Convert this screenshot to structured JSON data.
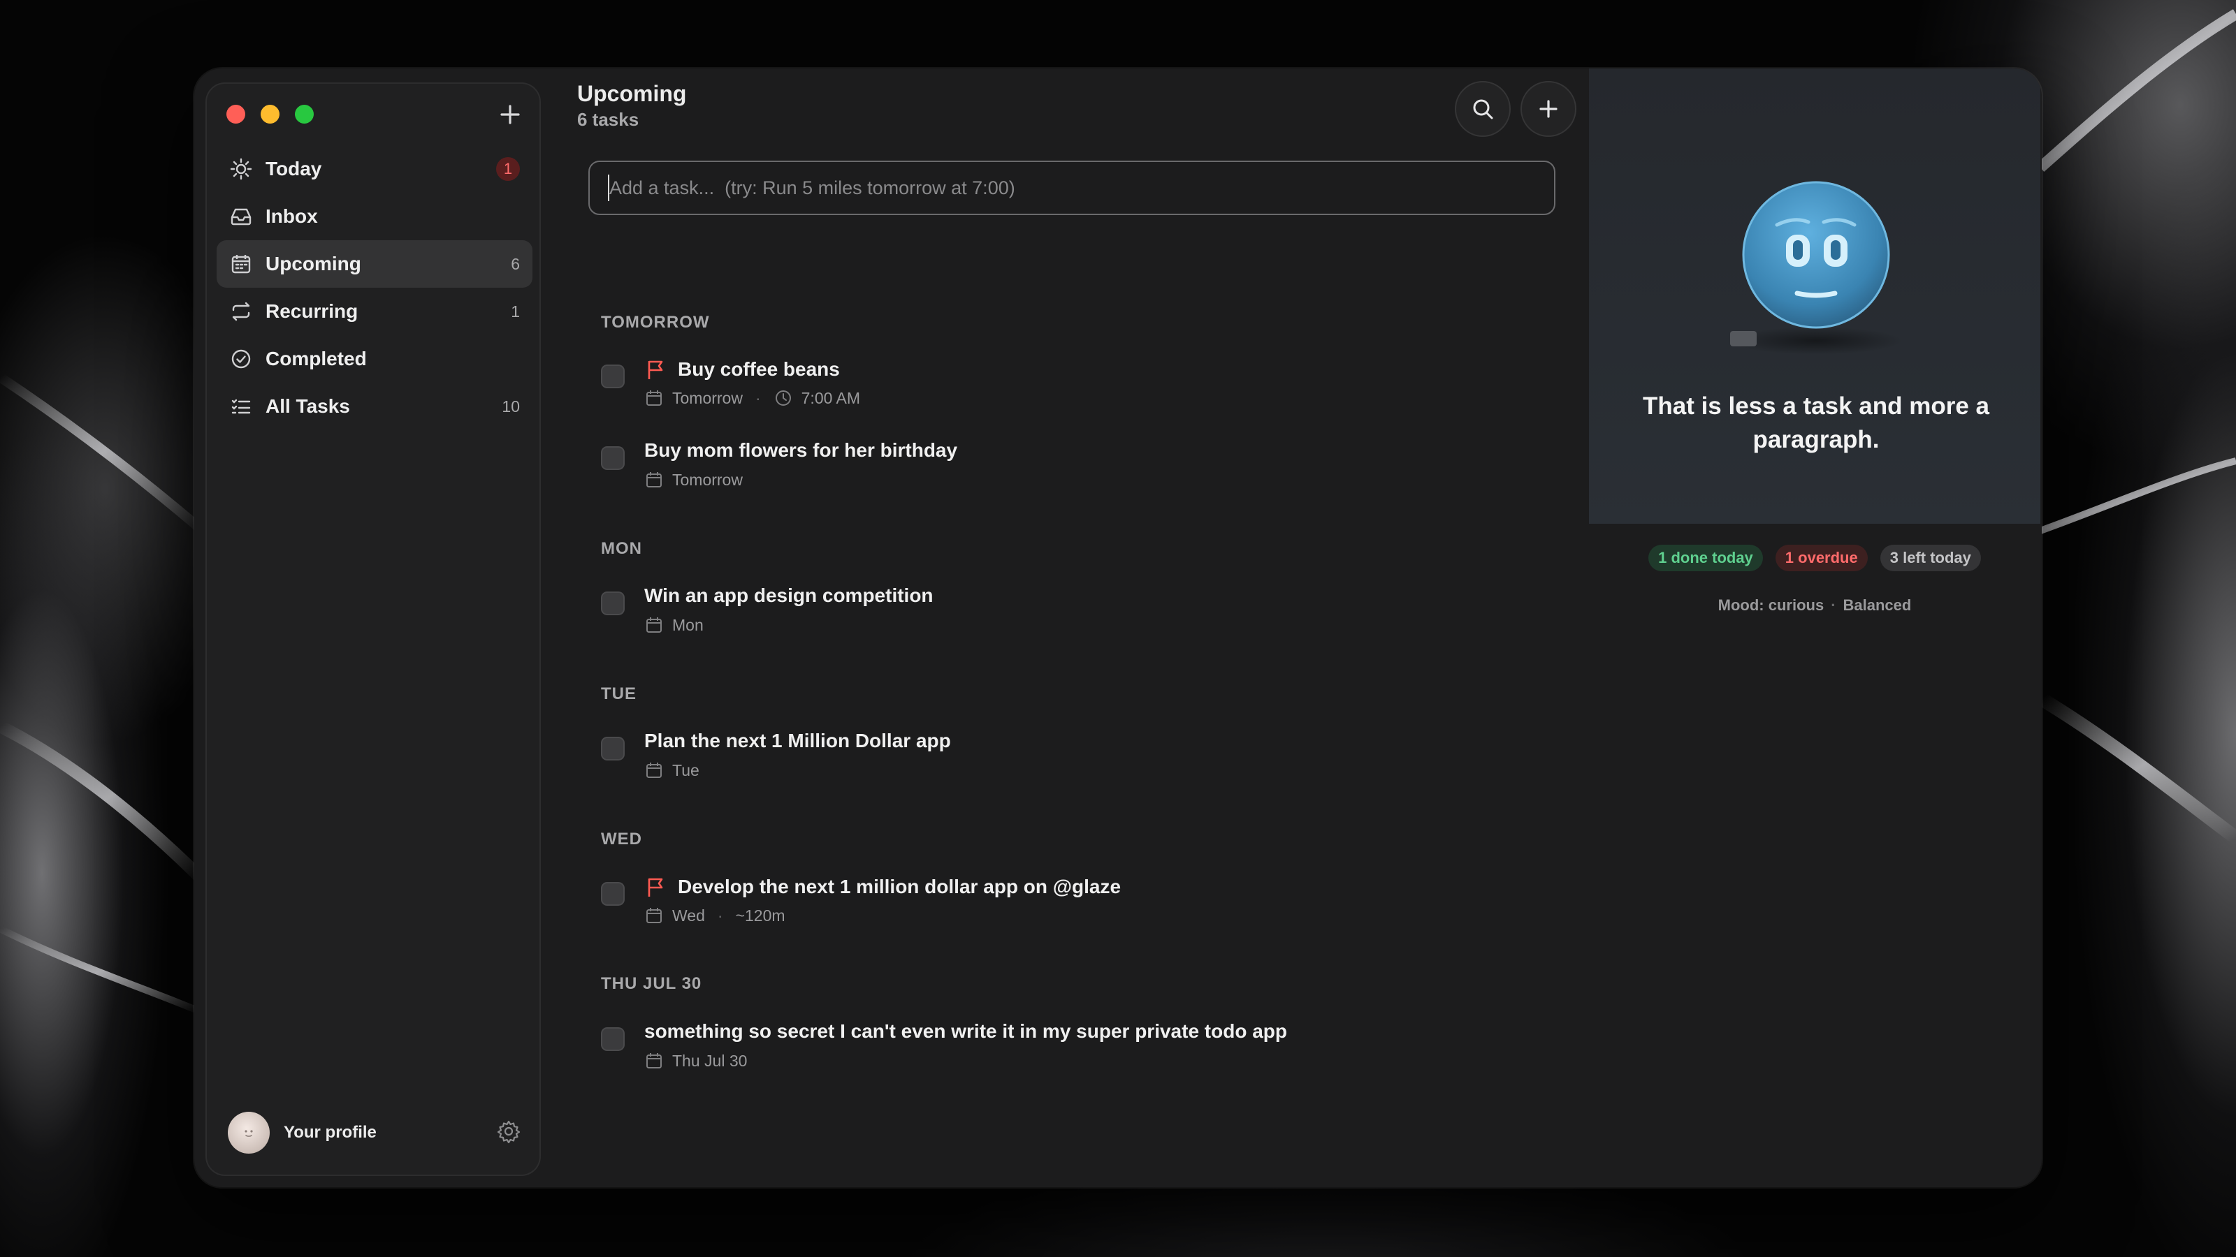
{
  "sidebar": {
    "items": [
      {
        "label": "Today",
        "count": "1",
        "icon": "sun-icon"
      },
      {
        "label": "Inbox",
        "count": "",
        "icon": "inbox-icon"
      },
      {
        "label": "Upcoming",
        "count": "6",
        "icon": "calendar-icon"
      },
      {
        "label": "Recurring",
        "count": "1",
        "icon": "repeat-icon"
      },
      {
        "label": "Completed",
        "count": "",
        "icon": "check-circle-icon"
      },
      {
        "label": "All Tasks",
        "count": "10",
        "icon": "list-icon"
      }
    ],
    "profile_label": "Your profile"
  },
  "header": {
    "title": "Upcoming",
    "subtitle": "6 tasks"
  },
  "add_task": {
    "placeholder": "Add a task...  (try: Run 5 miles tomorrow at 7:00)"
  },
  "sections": [
    {
      "heading": "TOMORROW",
      "tasks": [
        {
          "title": "Buy coffee beans",
          "flagged": true,
          "date": "Tomorrow",
          "time": "7:00 AM"
        },
        {
          "title": "Buy mom flowers for her birthday",
          "flagged": false,
          "date": "Tomorrow"
        }
      ]
    },
    {
      "heading": "MON",
      "tasks": [
        {
          "title": "Win an app design competition",
          "flagged": false,
          "date": "Mon"
        }
      ]
    },
    {
      "heading": "TUE",
      "tasks": [
        {
          "title": "Plan the next 1 Million Dollar app",
          "flagged": false,
          "date": "Tue"
        }
      ]
    },
    {
      "heading": "WED",
      "tasks": [
        {
          "title": "Develop the next 1 million dollar app on @glaze",
          "flagged": true,
          "date": "Wed",
          "duration": "~120m"
        }
      ]
    },
    {
      "heading": "THU JUL 30",
      "tasks": [
        {
          "title": "something so secret I can't even write it in my super private todo app",
          "flagged": false,
          "date": "Thu Jul 30"
        }
      ]
    }
  ],
  "assistant": {
    "message": "That is less a task and more a paragraph.",
    "stats": {
      "done": "1 done today",
      "overdue": "1 overdue",
      "left": "3 left today"
    },
    "mood": "Mood: curious",
    "mode": "Balanced"
  },
  "colors": {
    "flag": "#ff5a52",
    "done_green": "#5fd08f",
    "overdue_red": "#ff6b6b",
    "mascot_blue": "#3f8fbf"
  }
}
